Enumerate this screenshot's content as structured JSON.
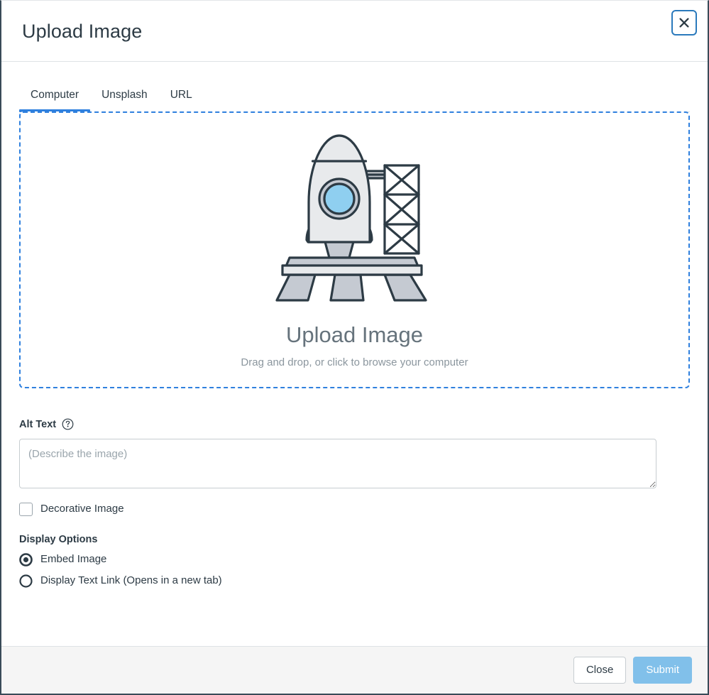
{
  "dialog": {
    "title": "Upload Image",
    "close_label": "×",
    "close_icon": "close-icon"
  },
  "tabs": [
    {
      "label": "Computer",
      "active": true
    },
    {
      "label": "Unsplash",
      "active": false
    },
    {
      "label": "URL",
      "active": false
    }
  ],
  "dropzone": {
    "title": "Upload Image",
    "subtitle": "Drag and drop, or click to browse your computer",
    "illustration": "rocket-on-launchpad-illustration",
    "border_color": "#2F80DE"
  },
  "alt_text": {
    "label": "Alt Text",
    "help_icon": "help-circle-icon",
    "placeholder": "(Describe the image)",
    "value": ""
  },
  "decorative": {
    "label": "Decorative Image",
    "checked": false
  },
  "display_options": {
    "label": "Display Options",
    "options": [
      {
        "label": "Embed Image",
        "selected": true
      },
      {
        "label": "Display Text Link (Opens in a new tab)",
        "selected": false
      }
    ]
  },
  "footer": {
    "close_label": "Close",
    "submit_label": "Submit",
    "submit_disabled": true
  },
  "colors": {
    "accent": "#2F80DE",
    "accent_border": "#2B7ABC",
    "text": "#2D3B45",
    "muted_text": "#8B969E",
    "submit_disabled_bg": "#81C0EA",
    "footer_bg": "#F5F5F5",
    "illustration_outline": "#2D3B45",
    "illustration_light": "#E8EAEC",
    "illustration_mid": "#C5CAD2",
    "porthole": "#8FCFF0"
  }
}
